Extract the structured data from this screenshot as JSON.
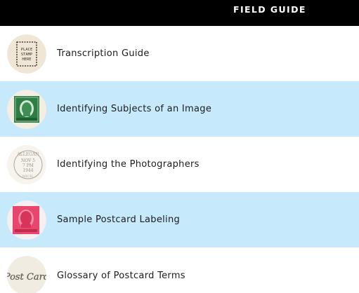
{
  "header": {
    "title": "FIELD GUIDE"
  },
  "items": [
    {
      "label": "Transcription Guide",
      "icon": "place-stamp-here-icon",
      "highlighted": false
    },
    {
      "label": "Identifying Subjects of an Image",
      "icon": "green-stamp-icon",
      "highlighted": true
    },
    {
      "label": "Identifying the Photographers",
      "icon": "postmark-icon",
      "highlighted": false
    },
    {
      "label": "Sample Postcard Labeling",
      "icon": "red-stamp-icon",
      "highlighted": true
    },
    {
      "label": "Glossary of Postcard Terms",
      "icon": "postcard-script-icon",
      "highlighted": false
    }
  ],
  "thumbnails": {
    "place_stamp_text": [
      "PLACE",
      "STAMP",
      "HERE"
    ],
    "postmark_text": [
      "ALLEGAN",
      "NOV 5",
      "7 PM",
      "1944",
      "MICH."
    ],
    "script_text": "Post Card"
  },
  "colors": {
    "header_bg": "#000000",
    "highlight_bg": "#c6e9fb",
    "stamp_green": "#2f7d45",
    "stamp_red": "#e8466c"
  }
}
